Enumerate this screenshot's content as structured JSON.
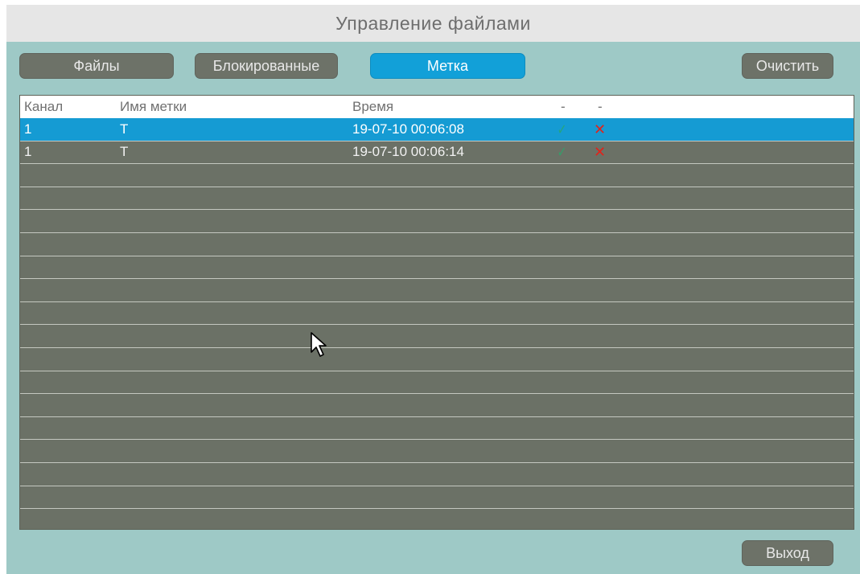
{
  "window": {
    "title": "Управление файлами"
  },
  "tabs": [
    {
      "label": "Файлы",
      "active": false
    },
    {
      "label": "Блокированные",
      "active": false
    },
    {
      "label": "Метка",
      "active": true
    }
  ],
  "toolbar": {
    "clear_label": "Очистить",
    "exit_label": "Выход"
  },
  "table": {
    "columns": [
      "Канал",
      "Имя метки",
      "Время",
      "-",
      "-"
    ],
    "rows": [
      {
        "channel": "1",
        "name": "T",
        "time": "19-07-10 00:06:08",
        "selected": true,
        "play_icon": "check-icon",
        "delete_icon": "cross-icon"
      },
      {
        "channel": "1",
        "name": "T",
        "time": "19-07-10 00:06:14",
        "selected": false,
        "play_icon": "check-icon",
        "delete_icon": "cross-icon"
      }
    ]
  },
  "colors": {
    "accent": "#12a0d8",
    "background": "#9ec9c6",
    "table_bg": "#6b7166",
    "delete": "#e0231b",
    "confirm": "#2aa86a"
  }
}
